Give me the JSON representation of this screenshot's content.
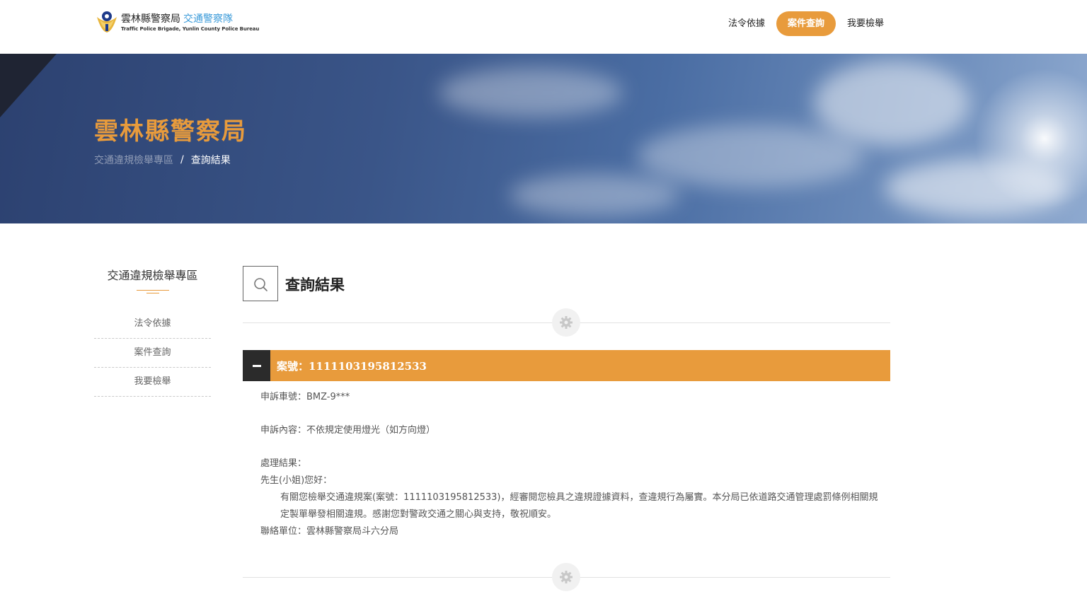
{
  "header": {
    "logo_cn": "雲林縣警察局",
    "logo_cn_accent": "交通警察隊",
    "logo_en": "Traffic Police Brigade, Yunlin County Police Bureau",
    "nav": [
      {
        "label": "法令依據",
        "active": false
      },
      {
        "label": "案件查詢",
        "active": true
      },
      {
        "label": "我要檢舉",
        "active": false
      }
    ]
  },
  "hero": {
    "title": "雲林縣警察局",
    "breadcrumb_link": "交通違規檢舉專區",
    "breadcrumb_sep": "/",
    "breadcrumb_current": "查詢結果"
  },
  "sidebar": {
    "title": "交通違規檢舉專區",
    "items": [
      "法令依據",
      "案件查詢",
      "我要檢舉"
    ]
  },
  "main": {
    "title": "查詢結果",
    "case_label": "案號：1111103195812533",
    "plate": "申訴車號：BMZ-9***",
    "content": "申訴內容：不依規定使用燈光（如方向燈）",
    "result_label": "處理結果：",
    "greeting": "先生(小姐)您好：",
    "result_text": "有關您檢舉交通違規案(案號：1111103195812533)，經審閱您檢具之違規證據資料，查違規行為屬實。本分局已依道路交通管理處罰條例相關規定製單舉發相關違規。感謝您對警政交通之關心與支持，敬祝順安。",
    "contact": "聯絡單位：雲林縣警察局斗六分局"
  },
  "colors": {
    "accent": "#e89b3c",
    "toggle_bg": "#2b2b2b"
  },
  "icons": [
    "police-badge-icon",
    "search-icon",
    "gear-icon",
    "minus-icon"
  ]
}
